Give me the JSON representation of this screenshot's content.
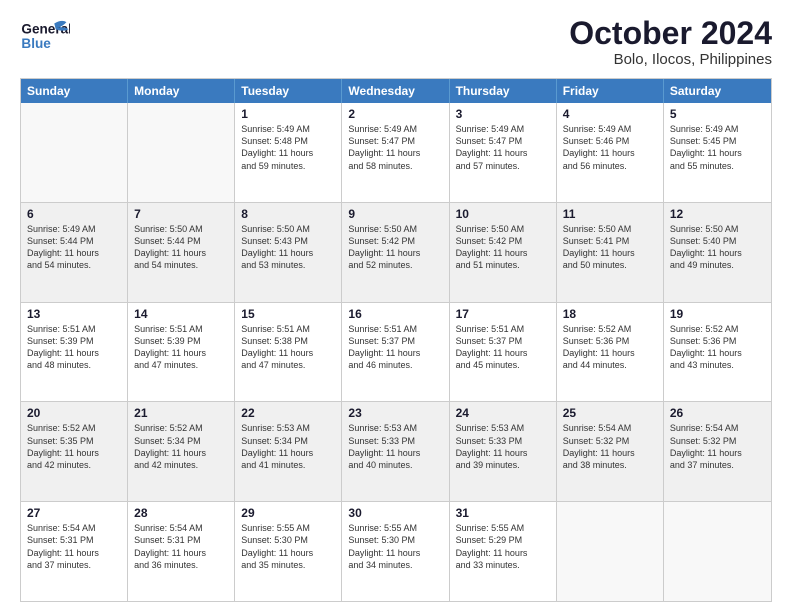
{
  "header": {
    "logo_line1": "General",
    "logo_line2": "Blue",
    "title": "October 2024",
    "subtitle": "Bolo, Ilocos, Philippines"
  },
  "weekdays": [
    "Sunday",
    "Monday",
    "Tuesday",
    "Wednesday",
    "Thursday",
    "Friday",
    "Saturday"
  ],
  "weeks": [
    [
      {
        "day": "",
        "info": "",
        "empty": true
      },
      {
        "day": "",
        "info": "",
        "empty": true
      },
      {
        "day": "1",
        "info": "Sunrise: 5:49 AM\nSunset: 5:48 PM\nDaylight: 11 hours\nand 59 minutes.",
        "empty": false
      },
      {
        "day": "2",
        "info": "Sunrise: 5:49 AM\nSunset: 5:47 PM\nDaylight: 11 hours\nand 58 minutes.",
        "empty": false
      },
      {
        "day": "3",
        "info": "Sunrise: 5:49 AM\nSunset: 5:47 PM\nDaylight: 11 hours\nand 57 minutes.",
        "empty": false
      },
      {
        "day": "4",
        "info": "Sunrise: 5:49 AM\nSunset: 5:46 PM\nDaylight: 11 hours\nand 56 minutes.",
        "empty": false
      },
      {
        "day": "5",
        "info": "Sunrise: 5:49 AM\nSunset: 5:45 PM\nDaylight: 11 hours\nand 55 minutes.",
        "empty": false
      }
    ],
    [
      {
        "day": "6",
        "info": "Sunrise: 5:49 AM\nSunset: 5:44 PM\nDaylight: 11 hours\nand 54 minutes.",
        "empty": false,
        "shaded": true
      },
      {
        "day": "7",
        "info": "Sunrise: 5:50 AM\nSunset: 5:44 PM\nDaylight: 11 hours\nand 54 minutes.",
        "empty": false,
        "shaded": true
      },
      {
        "day": "8",
        "info": "Sunrise: 5:50 AM\nSunset: 5:43 PM\nDaylight: 11 hours\nand 53 minutes.",
        "empty": false,
        "shaded": true
      },
      {
        "day": "9",
        "info": "Sunrise: 5:50 AM\nSunset: 5:42 PM\nDaylight: 11 hours\nand 52 minutes.",
        "empty": false,
        "shaded": true
      },
      {
        "day": "10",
        "info": "Sunrise: 5:50 AM\nSunset: 5:42 PM\nDaylight: 11 hours\nand 51 minutes.",
        "empty": false,
        "shaded": true
      },
      {
        "day": "11",
        "info": "Sunrise: 5:50 AM\nSunset: 5:41 PM\nDaylight: 11 hours\nand 50 minutes.",
        "empty": false,
        "shaded": true
      },
      {
        "day": "12",
        "info": "Sunrise: 5:50 AM\nSunset: 5:40 PM\nDaylight: 11 hours\nand 49 minutes.",
        "empty": false,
        "shaded": true
      }
    ],
    [
      {
        "day": "13",
        "info": "Sunrise: 5:51 AM\nSunset: 5:39 PM\nDaylight: 11 hours\nand 48 minutes.",
        "empty": false
      },
      {
        "day": "14",
        "info": "Sunrise: 5:51 AM\nSunset: 5:39 PM\nDaylight: 11 hours\nand 47 minutes.",
        "empty": false
      },
      {
        "day": "15",
        "info": "Sunrise: 5:51 AM\nSunset: 5:38 PM\nDaylight: 11 hours\nand 47 minutes.",
        "empty": false
      },
      {
        "day": "16",
        "info": "Sunrise: 5:51 AM\nSunset: 5:37 PM\nDaylight: 11 hours\nand 46 minutes.",
        "empty": false
      },
      {
        "day": "17",
        "info": "Sunrise: 5:51 AM\nSunset: 5:37 PM\nDaylight: 11 hours\nand 45 minutes.",
        "empty": false
      },
      {
        "day": "18",
        "info": "Sunrise: 5:52 AM\nSunset: 5:36 PM\nDaylight: 11 hours\nand 44 minutes.",
        "empty": false
      },
      {
        "day": "19",
        "info": "Sunrise: 5:52 AM\nSunset: 5:36 PM\nDaylight: 11 hours\nand 43 minutes.",
        "empty": false
      }
    ],
    [
      {
        "day": "20",
        "info": "Sunrise: 5:52 AM\nSunset: 5:35 PM\nDaylight: 11 hours\nand 42 minutes.",
        "empty": false,
        "shaded": true
      },
      {
        "day": "21",
        "info": "Sunrise: 5:52 AM\nSunset: 5:34 PM\nDaylight: 11 hours\nand 42 minutes.",
        "empty": false,
        "shaded": true
      },
      {
        "day": "22",
        "info": "Sunrise: 5:53 AM\nSunset: 5:34 PM\nDaylight: 11 hours\nand 41 minutes.",
        "empty": false,
        "shaded": true
      },
      {
        "day": "23",
        "info": "Sunrise: 5:53 AM\nSunset: 5:33 PM\nDaylight: 11 hours\nand 40 minutes.",
        "empty": false,
        "shaded": true
      },
      {
        "day": "24",
        "info": "Sunrise: 5:53 AM\nSunset: 5:33 PM\nDaylight: 11 hours\nand 39 minutes.",
        "empty": false,
        "shaded": true
      },
      {
        "day": "25",
        "info": "Sunrise: 5:54 AM\nSunset: 5:32 PM\nDaylight: 11 hours\nand 38 minutes.",
        "empty": false,
        "shaded": true
      },
      {
        "day": "26",
        "info": "Sunrise: 5:54 AM\nSunset: 5:32 PM\nDaylight: 11 hours\nand 37 minutes.",
        "empty": false,
        "shaded": true
      }
    ],
    [
      {
        "day": "27",
        "info": "Sunrise: 5:54 AM\nSunset: 5:31 PM\nDaylight: 11 hours\nand 37 minutes.",
        "empty": false
      },
      {
        "day": "28",
        "info": "Sunrise: 5:54 AM\nSunset: 5:31 PM\nDaylight: 11 hours\nand 36 minutes.",
        "empty": false
      },
      {
        "day": "29",
        "info": "Sunrise: 5:55 AM\nSunset: 5:30 PM\nDaylight: 11 hours\nand 35 minutes.",
        "empty": false
      },
      {
        "day": "30",
        "info": "Sunrise: 5:55 AM\nSunset: 5:30 PM\nDaylight: 11 hours\nand 34 minutes.",
        "empty": false
      },
      {
        "day": "31",
        "info": "Sunrise: 5:55 AM\nSunset: 5:29 PM\nDaylight: 11 hours\nand 33 minutes.",
        "empty": false
      },
      {
        "day": "",
        "info": "",
        "empty": true
      },
      {
        "day": "",
        "info": "",
        "empty": true
      }
    ]
  ]
}
